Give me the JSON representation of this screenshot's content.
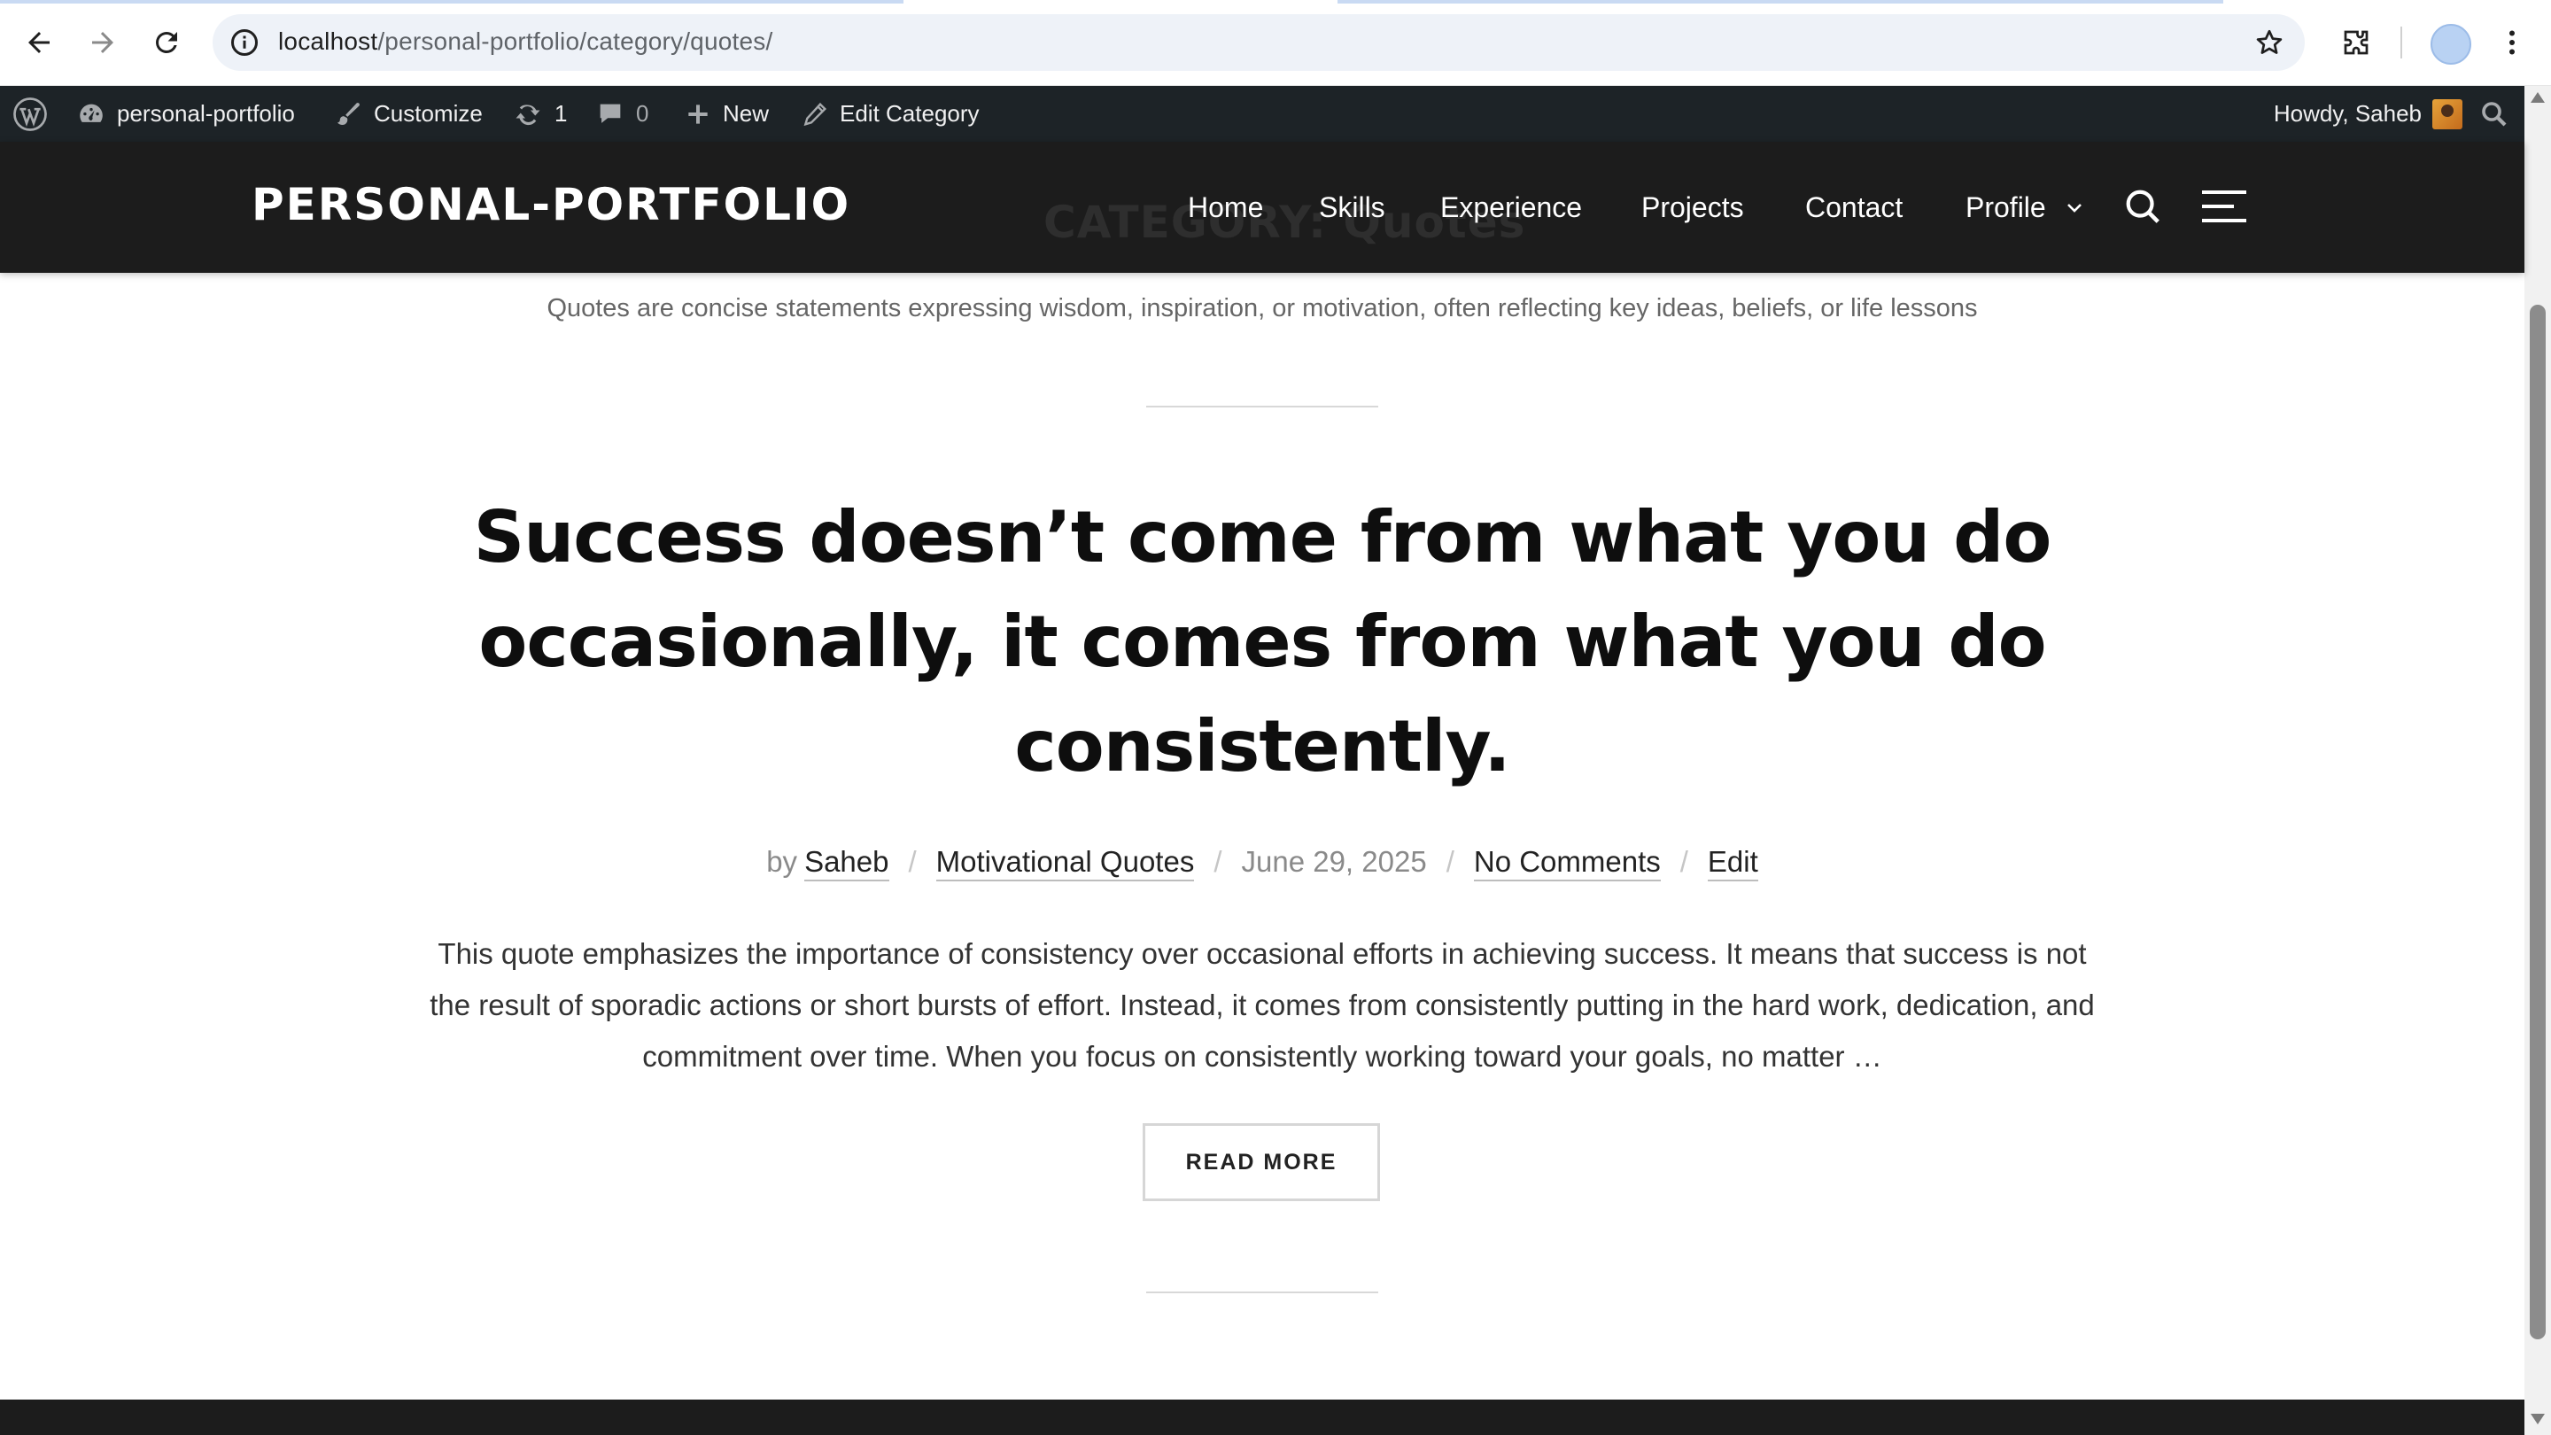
{
  "browser": {
    "url_host": "localhost",
    "url_path": "/personal-portfolio/category/quotes/"
  },
  "admin_bar": {
    "site_name": "personal-portfolio",
    "customize": "Customize",
    "updates_count": "1",
    "comments_count": "0",
    "new": "New",
    "edit_category": "Edit Category",
    "howdy": "Howdy, Saheb"
  },
  "site": {
    "title": "PERSONAL-PORTFOLIO",
    "category_heading": "CATEGORY: Quotes",
    "nav": [
      "Home",
      "Skills",
      "Experience",
      "Projects",
      "Contact",
      "Profile"
    ]
  },
  "category": {
    "description": "Quotes are concise statements expressing wisdom, inspiration, or motivation, often reflecting key ideas, beliefs, or life lessons"
  },
  "post": {
    "title": "Success doesn’t come from what you do occasionally, it comes from what you do consistently.",
    "by": "by",
    "author": "Saheb",
    "category": "Motivational Quotes",
    "date": "June 29, 2025",
    "comments": "No Comments",
    "edit": "Edit",
    "excerpt": "This quote emphasizes the importance of consistency over occasional efforts in achieving success. It means that success is not the result of sporadic actions or short bursts of effort. Instead, it comes from consistently putting in the hard work, dedication, and commitment over time. When you focus on consistently working toward your goals, no matter …",
    "read_more": "READ MORE"
  }
}
